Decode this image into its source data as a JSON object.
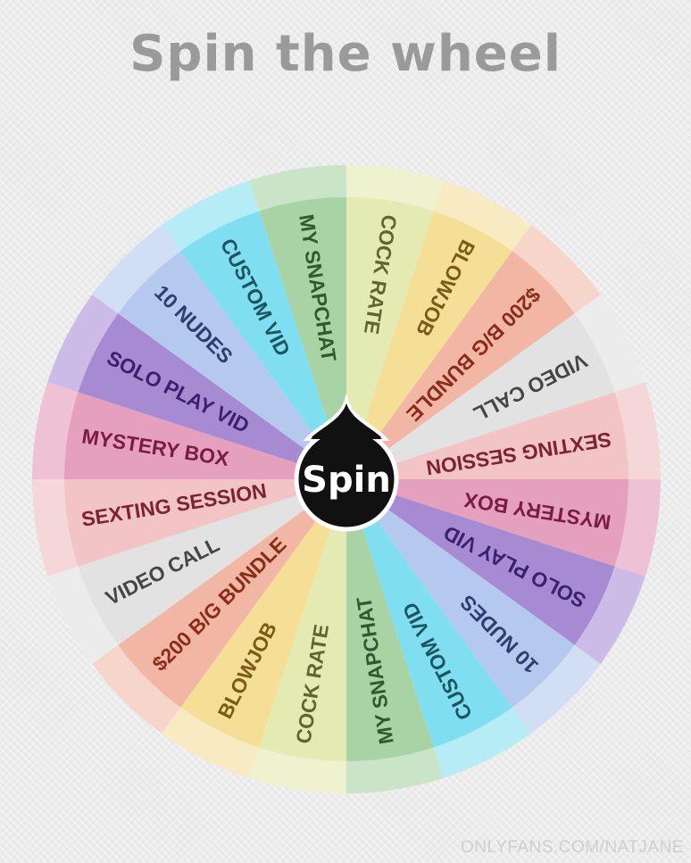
{
  "title": "Spin the wheel",
  "spin_label": "Spin",
  "watermark": "ONLYFANS.COM/NATJANE",
  "segments": [
    {
      "label": "COCK RATE",
      "fill": "#e4ebb2",
      "ring": "#eef2cf",
      "text": "#5d6630"
    },
    {
      "label": "BLOWJOB",
      "fill": "#f5df96",
      "ring": "#f8ebc2",
      "text": "#7a5a18"
    },
    {
      "label": "$200 B/G BUNDLE",
      "fill": "#f2b7a4",
      "ring": "#f6d5ca",
      "text": "#8a2c1c"
    },
    {
      "label": "VIDEO CALL",
      "fill": "#e2e2e2",
      "ring": "#ececec",
      "text": "#454545"
    },
    {
      "label": "SEXTING SESSION",
      "fill": "#f3c4c6",
      "ring": "#f5d7d8",
      "text": "#7a2430"
    },
    {
      "label": "MYSTERY BOX",
      "fill": "#e4a0bd",
      "ring": "#eec2d4",
      "text": "#7a1c42"
    },
    {
      "label": "SOLO PLAY VID",
      "fill": "#a78bd2",
      "ring": "#cbbbe6",
      "text": "#3a2170"
    },
    {
      "label": "10 NUDES",
      "fill": "#b5c9ee",
      "ring": "#d2def4",
      "text": "#2a3f6b"
    },
    {
      "label": "CUSTOM VID",
      "fill": "#7fdff1",
      "ring": "#b6ecf6",
      "text": "#1c5461"
    },
    {
      "label": "MY SNAPCHAT",
      "fill": "#a8d3a5",
      "ring": "#c9e4c6",
      "text": "#2f5a2f"
    },
    {
      "label": "COCK RATE",
      "fill": "#e4ebb2",
      "ring": "#eef2cf",
      "text": "#5d6630"
    },
    {
      "label": "BLOWJOB",
      "fill": "#f5df96",
      "ring": "#f8ebc2",
      "text": "#7a5a18"
    },
    {
      "label": "$200 B/G BUNDLE",
      "fill": "#f2b7a4",
      "ring": "#f6d5ca",
      "text": "#8a2c1c"
    },
    {
      "label": "VIDEO CALL",
      "fill": "#e2e2e2",
      "ring": "#ececec",
      "text": "#454545"
    },
    {
      "label": "SEXTING SESSION",
      "fill": "#f3c4c6",
      "ring": "#f5d7d8",
      "text": "#7a2430"
    },
    {
      "label": "MYSTERY BOX",
      "fill": "#e4a0bd",
      "ring": "#eec2d4",
      "text": "#7a1c42"
    },
    {
      "label": "SOLO PLAY VID",
      "fill": "#a78bd2",
      "ring": "#cbbbe6",
      "text": "#3a2170"
    },
    {
      "label": "10 NUDES",
      "fill": "#b5c9ee",
      "ring": "#d2def4",
      "text": "#2a3f6b"
    },
    {
      "label": "CUSTOM VID",
      "fill": "#7fdff1",
      "ring": "#b6ecf6",
      "text": "#1c5461"
    },
    {
      "label": "MY SNAPCHAT",
      "fill": "#a8d3a5",
      "ring": "#c9e4c6",
      "text": "#2f5a2f"
    }
  ]
}
